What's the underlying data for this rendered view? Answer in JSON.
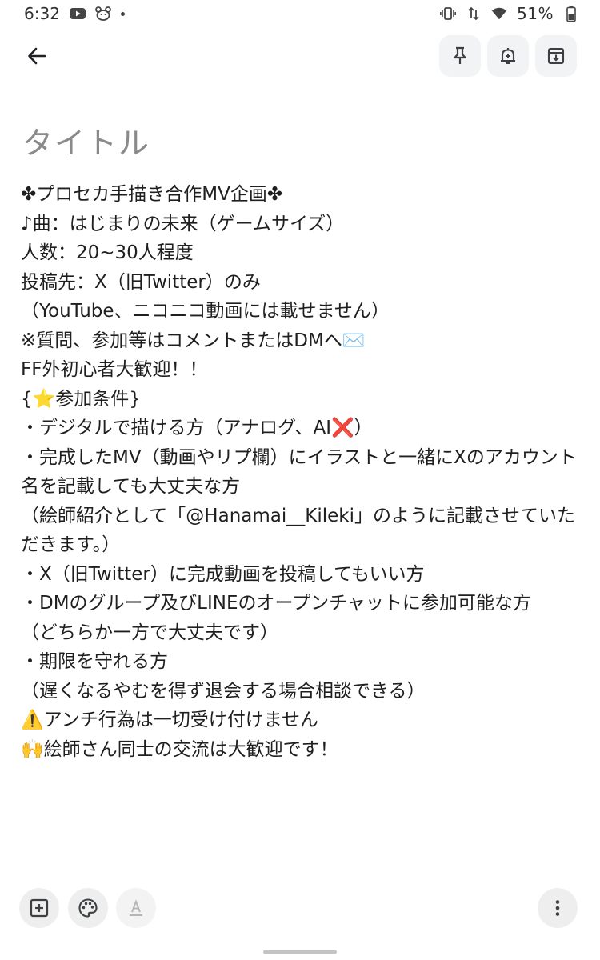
{
  "status_bar": {
    "time": "6:32",
    "battery": "51%",
    "icons": [
      "youtube-icon",
      "bear-icon",
      "dot-icon",
      "vibrate-icon",
      "data-arrows-icon",
      "wifi-icon",
      "battery-icon"
    ]
  },
  "toolbar": {
    "icons": [
      "back-arrow-icon",
      "pin-icon",
      "reminder-bell-icon",
      "archive-icon"
    ]
  },
  "note": {
    "title_placeholder": "タイトル",
    "lines": [
      "✤プロセカ手描き合作MV企画✤",
      "♪曲：はじまりの未来（ゲームサイズ）",
      "人数：20~30人程度",
      "投稿先：X（旧Twitter）のみ",
      "（YouTube、ニコニコ動画には載せません）",
      "※質問、参加等はコメントまたはDMへ✉️",
      "FF外初心者大歓迎！！",
      "{⭐参加条件}",
      "・デジタルで描ける方（アナログ、AI❌）",
      "・完成したMV（動画やリプ欄）にイラストと一緒にXのアカウント名を記載しても大丈夫な方",
      "（絵師紹介として「@Hanamai__Kileki」のように記載させていただきます。）",
      "・X（旧Twitter）に完成動画を投稿してもいい方",
      "・DMのグループ及びLINEのオープンチャットに参加可能な方",
      "（どちらか一方で大丈夫です）",
      "・期限を守れる方",
      "（遅くなるやむを得ず退会する場合相談できる）",
      "⚠️アンチ行為は一切受け付けません",
      "🙌絵師さん同士の交流は大歓迎です！"
    ]
  },
  "bottom_bar": {
    "icons": [
      "add-box-icon",
      "palette-icon",
      "text-format-icon",
      "more-vert-icon"
    ]
  }
}
